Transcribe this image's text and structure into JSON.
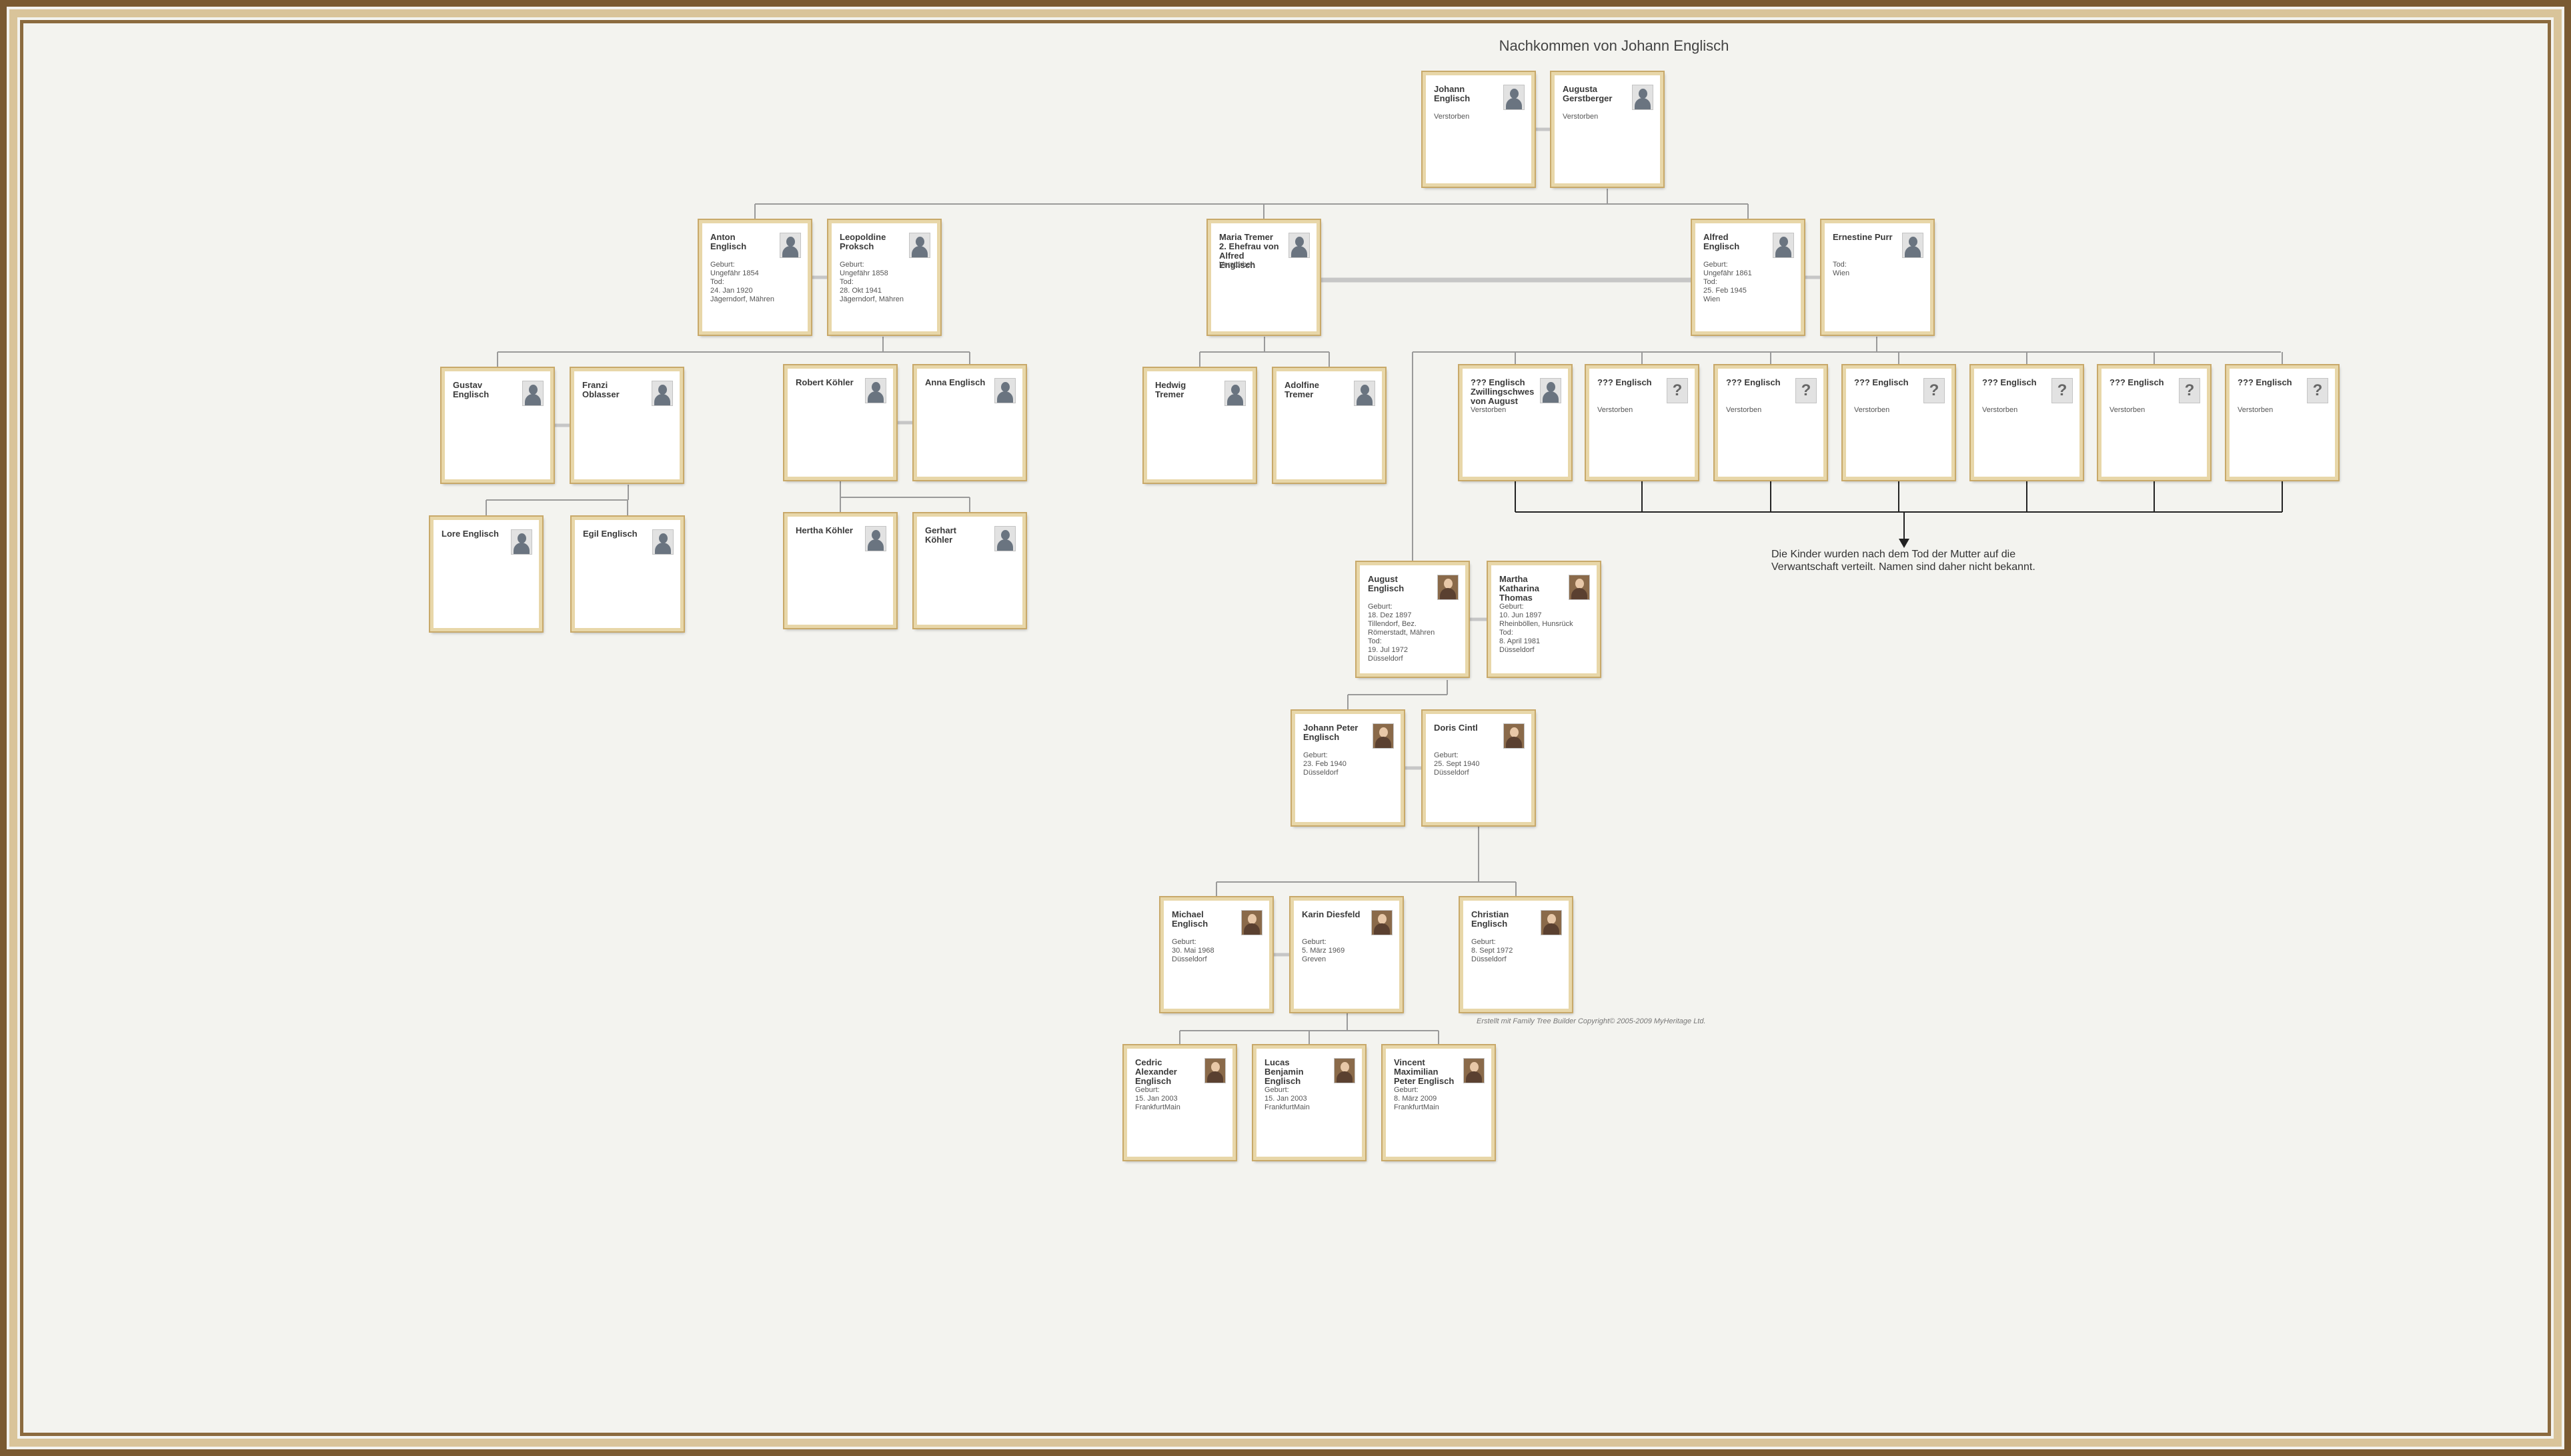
{
  "title": "Nachkommen von Johann Englisch",
  "note": "Die Kinder wurden nach dem Tod der Mutter auf die\nVerwantschaft verteilt. Namen sind daher nicht bekannt.",
  "credit": "Erstellt mit Family Tree Builder Copyright© 2005-2009 MyHeritage Ltd.",
  "persons": [
    {
      "name": "Johann\nEnglisch",
      "info": "Verstorben",
      "icon": "silhouette-icon"
    },
    {
      "name": "Augusta\nGerstberger",
      "info": "Verstorben",
      "icon": "silhouette-icon"
    },
    {
      "name": "Anton\nEnglisch",
      "info": "Geburt:\n  Ungefähr 1854\nTod:\n  24. Jan 1920\n  Jägerndorf, Mähren",
      "icon": "silhouette-icon"
    },
    {
      "name": "Leopoldine\nProksch",
      "info": "Geburt:\n  Ungefähr 1858\nTod:\n  28. Okt 1941\n  Jägerndorf, Mähren",
      "icon": "silhouette-icon"
    },
    {
      "name": "Maria  Tremer\n2. Ehefrau von\nAlfred\nEnglisch",
      "info": "Verstorben",
      "icon": "silhouette-icon"
    },
    {
      "name": "Alfred\nEnglisch",
      "info": "Geburt:\n  Ungefähr 1861\nTod:\n  25. Feb 1945\n  Wien",
      "icon": "silhouette-icon"
    },
    {
      "name": "Ernestine Purr",
      "info": "Tod:\n  Wien",
      "icon": "silhouette-icon"
    },
    {
      "name": "Gustav\nEnglisch",
      "info": "",
      "icon": "silhouette-icon"
    },
    {
      "name": "Franzi\nOblasser",
      "info": "",
      "icon": "silhouette-icon"
    },
    {
      "name": "Robert Köhler",
      "info": "",
      "icon": "silhouette-icon"
    },
    {
      "name": "Anna Englisch",
      "info": "",
      "icon": "silhouette-icon"
    },
    {
      "name": "Hedwig\nTremer",
      "info": "",
      "icon": "silhouette-icon"
    },
    {
      "name": "Adolfine\nTremer",
      "info": "",
      "icon": "silhouette-icon"
    },
    {
      "name": "??? Englisch\nZwillingschwes\nvon August",
      "info": "Verstorben",
      "icon": "silhouette-icon"
    },
    {
      "name": "??? Englisch",
      "info": "Verstorben",
      "icon": "question-icon"
    },
    {
      "name": "??? Englisch",
      "info": "Verstorben",
      "icon": "question-icon"
    },
    {
      "name": "??? Englisch",
      "info": "Verstorben",
      "icon": "question-icon"
    },
    {
      "name": "??? Englisch",
      "info": "Verstorben",
      "icon": "question-icon"
    },
    {
      "name": "??? Englisch",
      "info": "Verstorben",
      "icon": "question-icon"
    },
    {
      "name": "??? Englisch",
      "info": "Verstorben",
      "icon": "question-icon"
    },
    {
      "name": "Lore Englisch",
      "info": "",
      "icon": "silhouette-icon"
    },
    {
      "name": "Egil Englisch",
      "info": "",
      "icon": "silhouette-icon"
    },
    {
      "name": "Hertha Köhler",
      "info": "",
      "icon": "silhouette-icon"
    },
    {
      "name": "Gerhart\nKöhler",
      "info": "",
      "icon": "silhouette-icon"
    },
    {
      "name": "August\nEnglisch",
      "info": "Geburt:\n  18. Dez 1897\n  Tillendorf, Bez.\n  Römerstadt, Mähren\nTod:\n  19. Jul 1972\n  Düsseldorf",
      "icon": "photo-icon"
    },
    {
      "name": "Martha\nKatharina\nThomas",
      "info": "Geburt:\n  10. Jun 1897\n  Rheinböllen, Hunsrück\nTod:\n  8. April 1981\n  Düsseldorf",
      "icon": "photo-icon"
    },
    {
      "name": "Johann Peter\nEnglisch",
      "info": "Geburt:\n  23. Feb 1940\n  Düsseldorf",
      "icon": "photo-icon"
    },
    {
      "name": "Doris Cintl",
      "info": "Geburt:\n  25. Sept 1940\n  Düsseldorf",
      "icon": "photo-icon"
    },
    {
      "name": "Michael\nEnglisch",
      "info": "Geburt:\n  30. Mai 1968\n  Düsseldorf",
      "icon": "photo-icon"
    },
    {
      "name": "Karin Diesfeld",
      "info": "Geburt:\n  5. März 1969\n  Greven",
      "icon": "photo-icon"
    },
    {
      "name": "Christian\nEnglisch",
      "info": "Geburt:\n  8. Sept 1972\n  Düsseldorf",
      "icon": "photo-icon"
    },
    {
      "name": "Cedric\nAlexander\nEnglisch",
      "info": "Geburt:\n  15. Jan 2003\n  FrankfurtMain",
      "icon": "photo-icon"
    },
    {
      "name": "Lucas\nBenjamin\nEnglisch",
      "info": "Geburt:\n  15. Jan 2003\n  FrankfurtMain",
      "icon": "photo-icon"
    },
    {
      "name": "Vincent\nMaximilian\nPeter Englisch",
      "info": "Geburt:\n  8. März 2009\n  FrankfurtMain",
      "icon": "photo-icon"
    }
  ]
}
